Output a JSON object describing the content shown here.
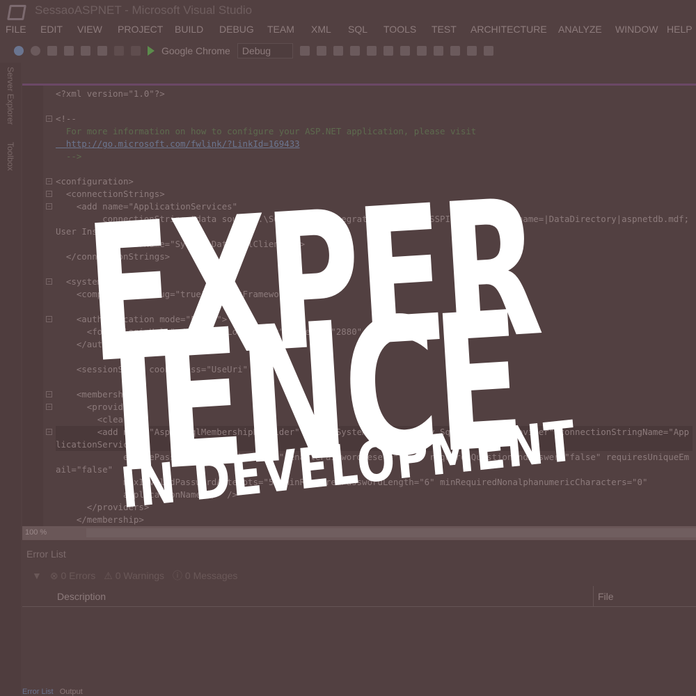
{
  "window": {
    "title": "SessaoASPNET - Microsoft Visual Studio"
  },
  "menu": [
    "FILE",
    "EDIT",
    "VIEW",
    "PROJECT",
    "BUILD",
    "DEBUG",
    "TEAM",
    "XML",
    "SQL",
    "TOOLS",
    "TEST",
    "ARCHITECTURE",
    "ANALYZE",
    "WINDOW",
    "HELP"
  ],
  "toolbar": {
    "run_target": "Google Chrome",
    "configuration": "Debug"
  },
  "sidebar": {
    "tabs": [
      "Server Explorer",
      "Toolbox"
    ]
  },
  "editor": {
    "lines": [
      "<?xml version=\"1.0\"?>",
      "",
      "<!--",
      "  For more information on how to configure your ASP.NET application, please visit",
      "  http://go.microsoft.com/fwlink/?LinkId=169433",
      "  -->",
      "",
      "<configuration>",
      "  <connectionStrings>",
      "    <add name=\"ApplicationServices\"",
      "         connectionString=\"data source=.\\SQLEXPRESS;Integrated Security=SSPI;AttachDBFilename=|DataDirectory|aspnetdb.mdf;User Instance=true\"",
      "         providerName=\"System.Data.SqlClient\" />",
      "  </connectionStrings>",
      "",
      "  <system.web>",
      "    <compilation debug=\"true\" targetFramework=\"4.0\" />",
      "",
      "    <authentication mode=\"Forms\">",
      "      <forms loginUrl=\"~/Account/Login.aspx\" timeout=\"2880\" />",
      "    </authentication>",
      "",
      "    <sessionState cookieless=\"UseUri\" />",
      "",
      "    <membership>",
      "      <providers>",
      "        <clear/>",
      "        <add name=\"AspNetSqlMembershipProvider\" type=\"System.Web.Security.SqlMembershipProvider\" connectionStringName=\"ApplicationServices\"",
      "             enablePasswordRetrieval=\"false\" enablePasswordReset=\"true\" requiresQuestionAndAnswer=\"false\" requiresUniqueEmail=\"false\"",
      "             maxInvalidPasswordAttempts=\"5\" minRequiredPasswordLength=\"6\" minRequiredNonalphanumericCharacters=\"0\"",
      "             applicationName=\"/\" />",
      "      </providers>",
      "    </membership>"
    ],
    "zoom": "100 %"
  },
  "error_list": {
    "title": "Error List",
    "errors": "0 Errors",
    "warnings": "0 Warnings",
    "messages": "0 Messages",
    "columns": [
      "Description",
      "File"
    ]
  },
  "bottom_tabs": [
    "Error List",
    "Output"
  ],
  "overlay": {
    "line1": "EXPER",
    "line2": "IENCE",
    "line3": "IN DEVELOPMENT"
  }
}
